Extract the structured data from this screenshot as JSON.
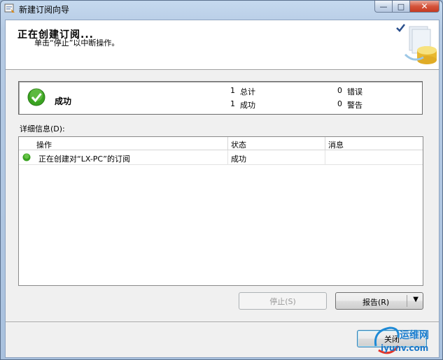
{
  "window": {
    "title": "新建订阅向导",
    "controls": {
      "minimize": "—",
      "maximize": "□",
      "close": "✕"
    }
  },
  "header": {
    "title": "正在创建订阅...",
    "subtitle": "单击“停止”以中断操作。"
  },
  "summary": {
    "status": "成功",
    "counts": [
      {
        "value": "1",
        "label": "总计"
      },
      {
        "value": "0",
        "label": "错误"
      },
      {
        "value": "1",
        "label": "成功"
      },
      {
        "value": "0",
        "label": "警告"
      }
    ]
  },
  "details": {
    "label": "详细信息(D):",
    "columns": [
      "操作",
      "状态",
      "消息"
    ],
    "rows": [
      {
        "action": "正在创建对“LX-PC”的订阅",
        "status": "成功",
        "message": ""
      }
    ]
  },
  "buttons": {
    "stop": "停止(S)",
    "report": "报告(R)",
    "report_arrow": "▼",
    "close": "关闭"
  },
  "watermark": {
    "brand": "运维网",
    "url": "iyunv.com"
  },
  "colors": {
    "success_green": "#3aa321",
    "titlebar": "#c5d9ef",
    "dialog_bg": "#f0f0f0"
  },
  "icons": {
    "app": "wizard-icon",
    "status": "success-check-icon",
    "header_art": "publication-database-icon"
  }
}
